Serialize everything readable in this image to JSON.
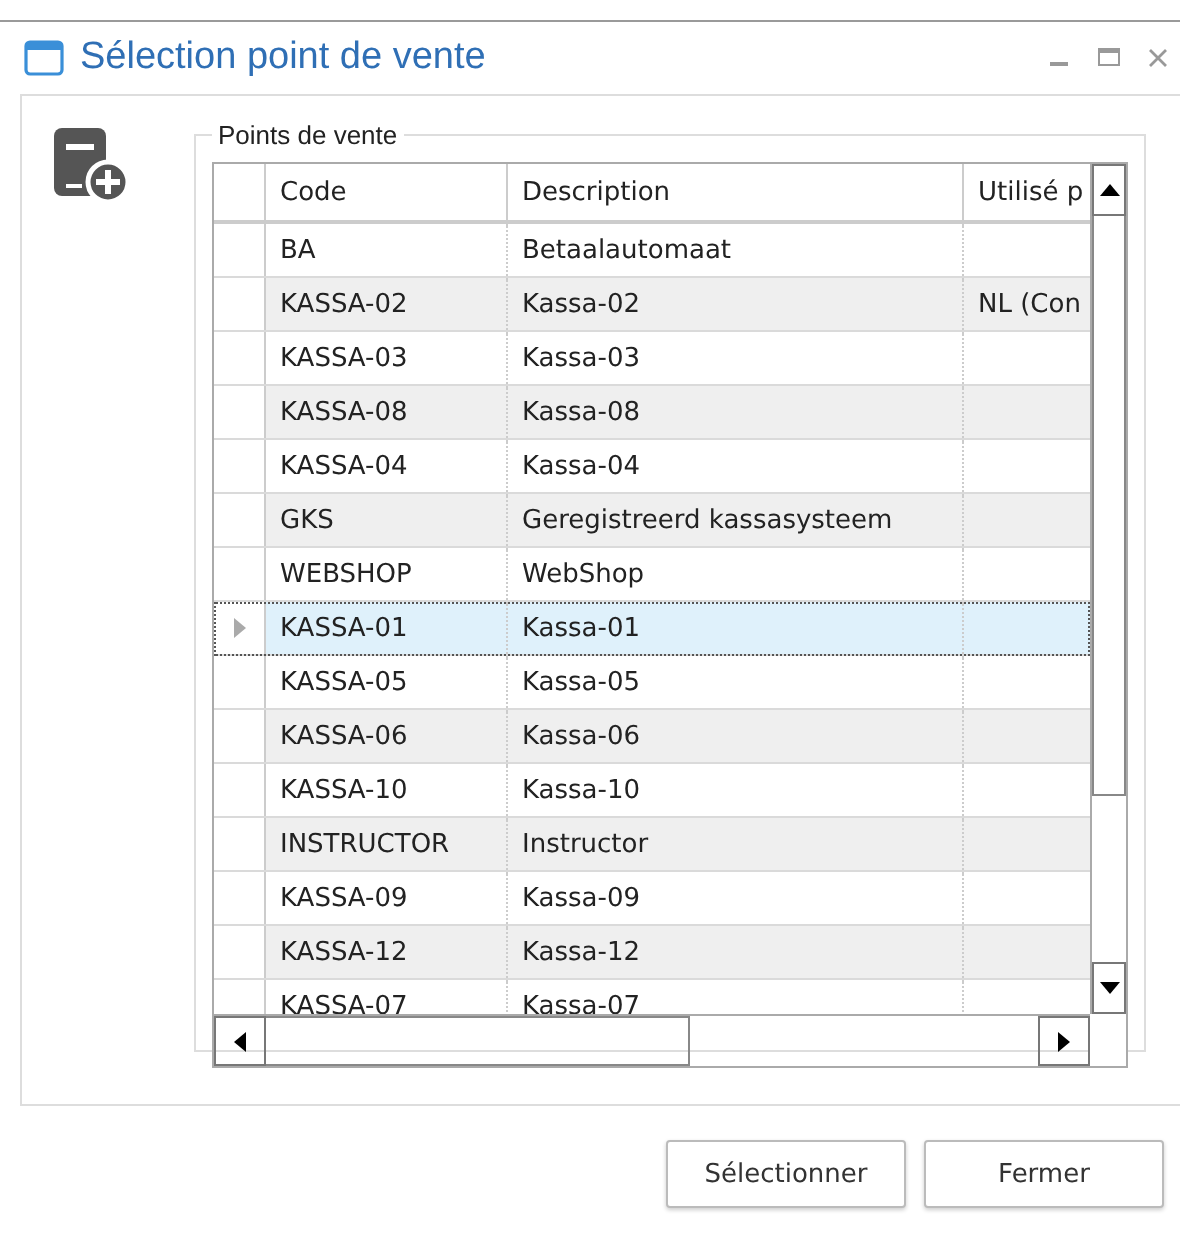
{
  "window": {
    "title": "Sélection point de vente"
  },
  "group": {
    "label": "Points de vente"
  },
  "table": {
    "columns": [
      "Code",
      "Description",
      "Utilisé p"
    ],
    "rows": [
      {
        "code": "BA",
        "description": "Betaalautomaat",
        "used": "",
        "selected": false
      },
      {
        "code": "KASSA-02",
        "description": "Kassa-02",
        "used": "NL (Con",
        "selected": false
      },
      {
        "code": "KASSA-03",
        "description": "Kassa-03",
        "used": "",
        "selected": false
      },
      {
        "code": "KASSA-08",
        "description": "Kassa-08",
        "used": "",
        "selected": false
      },
      {
        "code": "KASSA-04",
        "description": "Kassa-04",
        "used": "",
        "selected": false
      },
      {
        "code": "GKS",
        "description": "Geregistreerd kassasysteem",
        "used": "",
        "selected": false
      },
      {
        "code": "WEBSHOP",
        "description": "WebShop",
        "used": "",
        "selected": false
      },
      {
        "code": "KASSA-01",
        "description": "Kassa-01",
        "used": "",
        "selected": true
      },
      {
        "code": "KASSA-05",
        "description": "Kassa-05",
        "used": "",
        "selected": false
      },
      {
        "code": "KASSA-06",
        "description": "Kassa-06",
        "used": "",
        "selected": false
      },
      {
        "code": "KASSA-10",
        "description": "Kassa-10",
        "used": "",
        "selected": false
      },
      {
        "code": "INSTRUCTOR",
        "description": "Instructor",
        "used": "",
        "selected": false
      },
      {
        "code": "KASSA-09",
        "description": "Kassa-09",
        "used": "",
        "selected": false
      },
      {
        "code": "KASSA-12",
        "description": "Kassa-12",
        "used": "",
        "selected": false
      },
      {
        "code": "KASSA-07",
        "description": "Kassa-07",
        "used": "",
        "selected": false
      }
    ]
  },
  "buttons": [
    "Sélectionner",
    "Fermer"
  ]
}
